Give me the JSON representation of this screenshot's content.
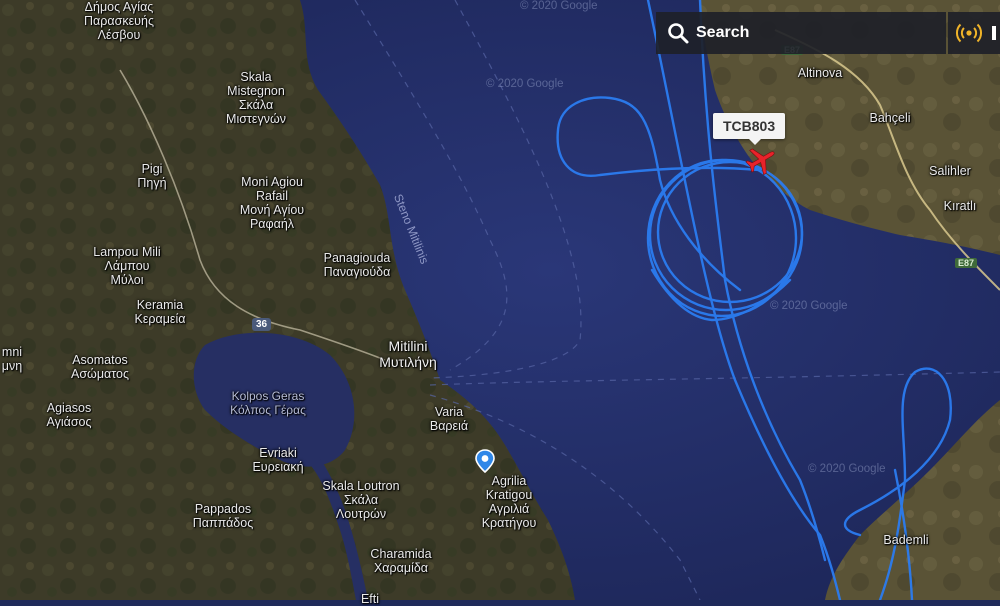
{
  "search": {
    "label": "Search"
  },
  "flight": {
    "callsign": "TCB803"
  },
  "watermark": "© 2020 Google",
  "road_badges": {
    "r36": "36",
    "e87": "E87"
  },
  "strait_label": "Steno Mitilinis",
  "places": [
    {
      "id": "dimos-agias",
      "name": "Δήμος Αγίας",
      "name2": "Παρασκευής",
      "name3": "Λέσβου"
    },
    {
      "id": "skala-mistegnon",
      "name": "Skala",
      "name2": "Mistegnon",
      "name3": "Σκάλα",
      "name4": "Μιστεγνών"
    },
    {
      "id": "pigi",
      "name": "Pigi",
      "name2": "Πηγή"
    },
    {
      "id": "moni-agiou-rafail",
      "name": "Moni Agiou",
      "name2": "Rafail",
      "name3": "Μονή Αγίου",
      "name4": "Ραφαήλ"
    },
    {
      "id": "lampou-mili",
      "name": "Lampou Mili",
      "name2": "Λάμπου",
      "name3": "Μύλοι"
    },
    {
      "id": "panagiouda",
      "name": "Panagiouda",
      "name2": "Παναγιούδα"
    },
    {
      "id": "keramia",
      "name": "Keramia",
      "name2": "Κεραμεία"
    },
    {
      "id": "mitilini",
      "name": "Mitilini",
      "name2": "Μυτιλήνη"
    },
    {
      "id": "asomatos",
      "name": "Asomatos",
      "name2": "Ασώματος"
    },
    {
      "id": "mni",
      "name": "mni",
      "name2": "μνη"
    },
    {
      "id": "kolpos-geras",
      "name": "Kolpos Geras",
      "name2": "Κόλπος Γέρας"
    },
    {
      "id": "agiasos",
      "name": "Agiasos",
      "name2": "Αγιάσος"
    },
    {
      "id": "varia",
      "name": "Varia",
      "name2": "Βαρειά"
    },
    {
      "id": "evriaki",
      "name": "Evriaki",
      "name2": "Ευρειακή"
    },
    {
      "id": "skala-loutron",
      "name": "Skala Loutron",
      "name2": "Σκάλα",
      "name3": "Λουτρών"
    },
    {
      "id": "pappados",
      "name": "Pappados",
      "name2": "Παππάδος"
    },
    {
      "id": "agrilia-kratigou",
      "name": "Agrilia",
      "name2": "Kratigou",
      "name3": "Αγριλιά",
      "name4": "Κρατήγου"
    },
    {
      "id": "charamida",
      "name": "Charamida",
      "name2": "Χαραμίδα"
    },
    {
      "id": "efti",
      "name": "Efti"
    },
    {
      "id": "altinova",
      "name": "Altinova"
    },
    {
      "id": "bahceli",
      "name": "Bahçeli"
    },
    {
      "id": "salihler",
      "name": "Salihler"
    },
    {
      "id": "kiratli",
      "name": "Kıratlı"
    },
    {
      "id": "bademli",
      "name": "Bademli"
    }
  ]
}
